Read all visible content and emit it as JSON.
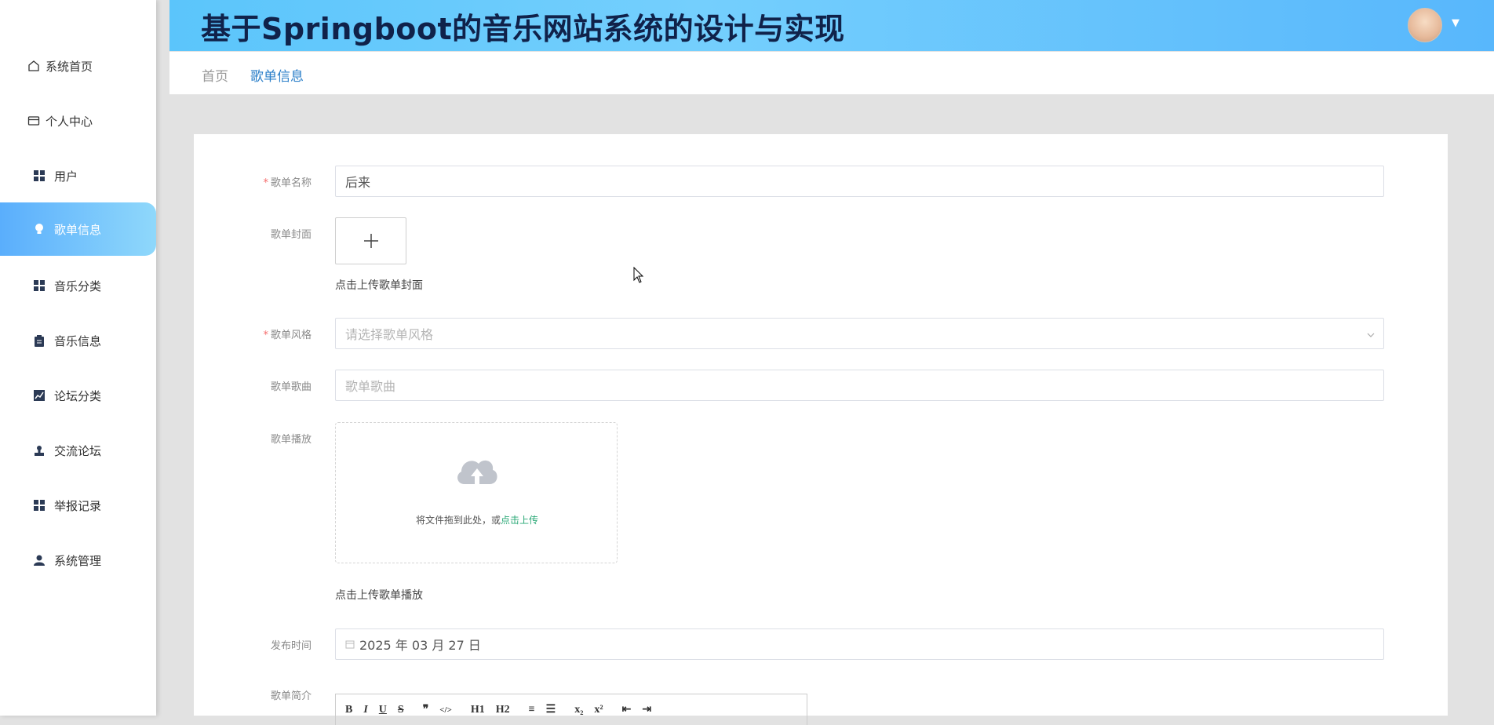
{
  "header": {
    "title": "基于Springboot的音乐网站系统的设计与实现"
  },
  "sidebar": {
    "items": [
      {
        "label": "系统首页",
        "icon": "home-icon"
      },
      {
        "label": "个人中心",
        "icon": "card-icon"
      },
      {
        "label": "用户",
        "icon": "grid-icon"
      },
      {
        "label": "歌单信息",
        "icon": "bulb-icon",
        "active": true
      },
      {
        "label": "音乐分类",
        "icon": "grid-icon"
      },
      {
        "label": "音乐信息",
        "icon": "clipboard-icon"
      },
      {
        "label": "论坛分类",
        "icon": "chart-icon"
      },
      {
        "label": "交流论坛",
        "icon": "stamp-icon"
      },
      {
        "label": "举报记录",
        "icon": "grid-icon"
      },
      {
        "label": "系统管理",
        "icon": "user-icon"
      }
    ]
  },
  "breadcrumb": {
    "home": "首页",
    "current": "歌单信息"
  },
  "form": {
    "name_label": "歌单名称",
    "name_value": "后来",
    "cover_label": "歌单封面",
    "cover_hint": "点击上传歌单封面",
    "style_label": "歌单风格",
    "style_placeholder": "请选择歌单风格",
    "songs_label": "歌单歌曲",
    "songs_placeholder": "歌单歌曲",
    "play_label": "歌单播放",
    "dz_text": "将文件拖到此处，或",
    "dz_link": "点击上传",
    "play_hint": "点击上传歌单播放",
    "date_label": "发布时间",
    "date_value": "2025 年 03 月 27 日",
    "intro_label": "歌单简介"
  },
  "toolbar": [
    "B",
    "I",
    "U",
    "S",
    "❞",
    "</>",
    "H1",
    "H2",
    "≡",
    "☰",
    "x₂",
    "x²",
    "⇤",
    "⇥"
  ],
  "colors": {
    "accent": "#2b7fc9",
    "active_menu": "#5aaefc",
    "link_green": "#2aa876"
  }
}
